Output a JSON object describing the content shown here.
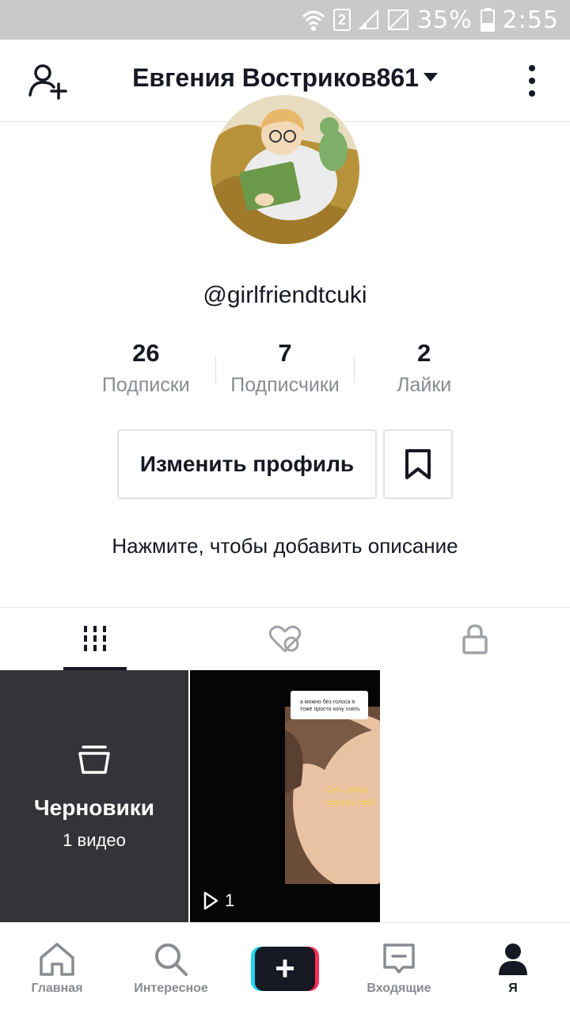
{
  "status_bar": {
    "battery": "35%",
    "time": "2:55",
    "sim": "2"
  },
  "header": {
    "title": "Евгения Востриков861"
  },
  "profile": {
    "username": "@girlfriendtcuki",
    "stats": [
      {
        "value": "26",
        "label": "Подписки"
      },
      {
        "value": "7",
        "label": "Подписчики"
      },
      {
        "value": "2",
        "label": "Лайки"
      }
    ],
    "edit_label": "Изменить профиль",
    "bio_prompt": "Нажмите, чтобы добавить описание"
  },
  "grid": {
    "drafts_title": "Черновики",
    "drafts_count": "1 видео",
    "video_plays": "1",
    "video_comment": "а можно без голоса я тоже просто хочу снять",
    "video_caption_line1": "Суть тренд",
    "video_caption_line2": "спалить свой"
  },
  "bottom_nav": [
    {
      "label": "Главная",
      "icon": "home-icon"
    },
    {
      "label": "Интересное",
      "icon": "search-icon"
    },
    {
      "label": "",
      "icon": "plus-icon"
    },
    {
      "label": "Входящие",
      "icon": "inbox-icon"
    },
    {
      "label": "Я",
      "icon": "profile-icon"
    }
  ],
  "colors": {
    "accent_cyan": "#20d5ec",
    "accent_red": "#fe2c55",
    "text_primary": "#161823",
    "text_secondary": "#8a8b91"
  }
}
